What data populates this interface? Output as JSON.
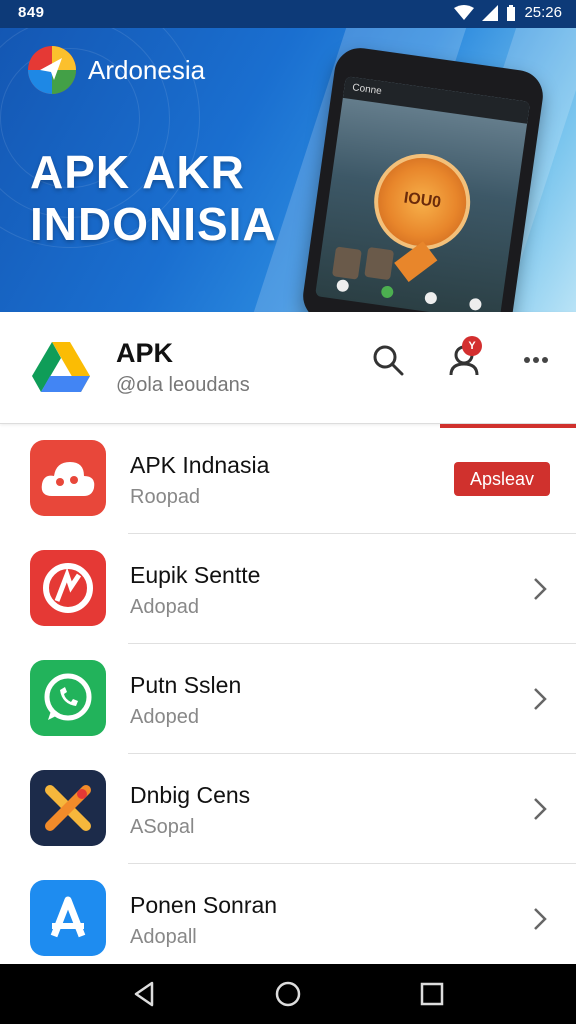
{
  "status_bar": {
    "left_time": "849",
    "right_time": "25:26"
  },
  "banner": {
    "brand_name": "Ardonesia",
    "title_line1": "APK AKR",
    "title_line2": "INDONISIA",
    "phone_screen_label": "Conne",
    "phone_badge_text": "IOU0"
  },
  "header": {
    "title": "APK",
    "subtitle": "@ola leoudans",
    "notification_count": "Y"
  },
  "list": [
    {
      "name": "APK Indnasia",
      "sub": "Roopad",
      "action": "Apsleav",
      "icon": "cloud-icon",
      "color": "#e8473a"
    },
    {
      "name": "Eupik Sentte",
      "sub": "Adopad",
      "icon": "red-swirl-icon",
      "color": "#e53935"
    },
    {
      "name": "Putn Sslen",
      "sub": "Adoped",
      "icon": "whatsapp-icon",
      "color": "#22b35b"
    },
    {
      "name": "Dnbig Cens",
      "sub": "ASopal",
      "icon": "x-pen-icon",
      "color": "#1c2b4a"
    },
    {
      "name": "Ponen Sonran",
      "sub": "Adopall",
      "icon": "app-store-icon",
      "color": "#1e8cf0"
    }
  ]
}
